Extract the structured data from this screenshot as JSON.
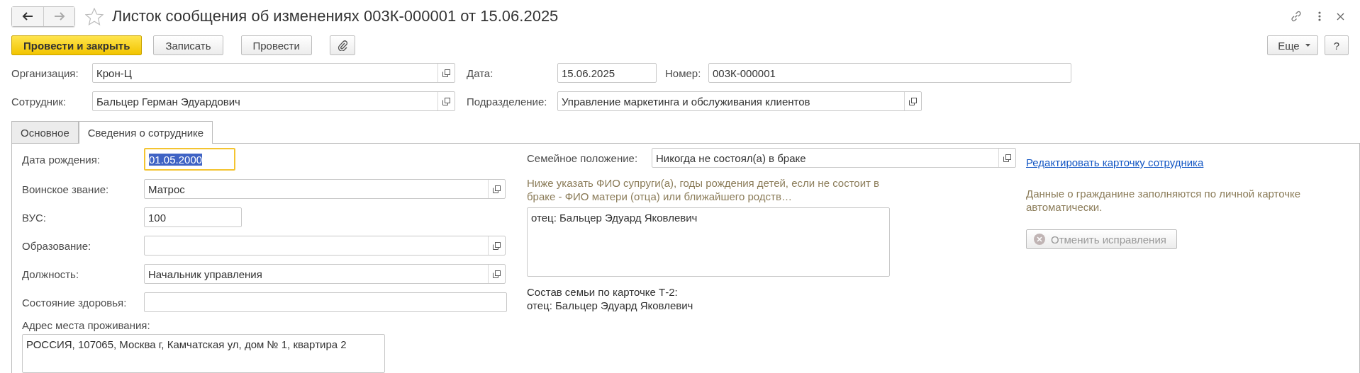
{
  "window": {
    "title": "Листок сообщения об изменениях 003К-000001 от 15.06.2025",
    "back": {
      "disabled": false
    },
    "forward": {
      "disabled": true
    },
    "favorite": false
  },
  "toolbar": [
    {
      "kind": "primary",
      "label": "Провести и закрыть"
    },
    {
      "kind": "normal",
      "label": "Записать"
    },
    {
      "kind": "normal",
      "label": "Провести"
    },
    {
      "kind": "attach"
    }
  ],
  "toolbar_right": [
    {
      "kind": "menu",
      "label": "Еще"
    },
    {
      "kind": "normal",
      "label": "?"
    }
  ],
  "header_rows": [
    [
      {
        "label": "Организация:",
        "value": "Крон-Ц",
        "picker": true
      },
      {
        "label": "Дата:",
        "value": "15.06.2025",
        "picker": false
      },
      {
        "label": "Номер:",
        "value": "003К-000001",
        "picker": false
      }
    ],
    [
      {
        "label": "Сотрудник:",
        "value": "Бальцер Герман Эдуардович",
        "picker": true
      },
      {
        "label": "Подразделение:",
        "value": "Управление маркетинга и обслуживания клиентов",
        "picker": true
      }
    ]
  ],
  "tabs": [
    {
      "label": "Основное",
      "selected": false
    },
    {
      "label": "Сведения о сотруднике",
      "selected": true
    }
  ],
  "employee_fields": [
    {
      "label": "Дата рождения:",
      "value": "01.05.2000",
      "picker": false,
      "focused": true,
      "text_selected": true
    },
    {
      "label": "Воинское звание:",
      "value": "Матрос",
      "picker": true,
      "focused": false,
      "text_selected": false
    },
    {
      "label": "ВУС:",
      "value": "100",
      "picker": false,
      "focused": false,
      "text_selected": false
    },
    {
      "label": "Образование:",
      "picker": true,
      "focused": false
    },
    {
      "label": "Должность:",
      "value": "Начальник управления",
      "picker": true,
      "focused": false,
      "text_selected": false
    },
    {
      "label": "Состояние здоровья:",
      "picker": false,
      "focused": false
    }
  ],
  "address": {
    "label": "Адрес места проживания:",
    "value": "РОССИЯ, 107065, Москва г, Камчатская ул, дом № 1, квартира 2"
  },
  "marital_status": {
    "label": "Семейное положение:",
    "value": "Никогда не состоял(а) в браке",
    "picker": true
  },
  "family_hint": "Ниже указать ФИО супруги(а), годы рождения детей, если не состоит в браке - ФИО матери (отца) или ближайшего родств…",
  "family_notes": "отец: Бальцер Эдуард Яковлевич",
  "family_card": [
    "Состав семьи по карточке Т-2:",
    "отец: Бальцер Эдуард Яковлевич"
  ],
  "edit_link": "Редактировать карточку сотрудника",
  "info_text": "Данные о гражданине заполняются по личной карточке автоматически.",
  "cancel_button": {
    "label": "Отменить исправления",
    "disabled": true
  }
}
